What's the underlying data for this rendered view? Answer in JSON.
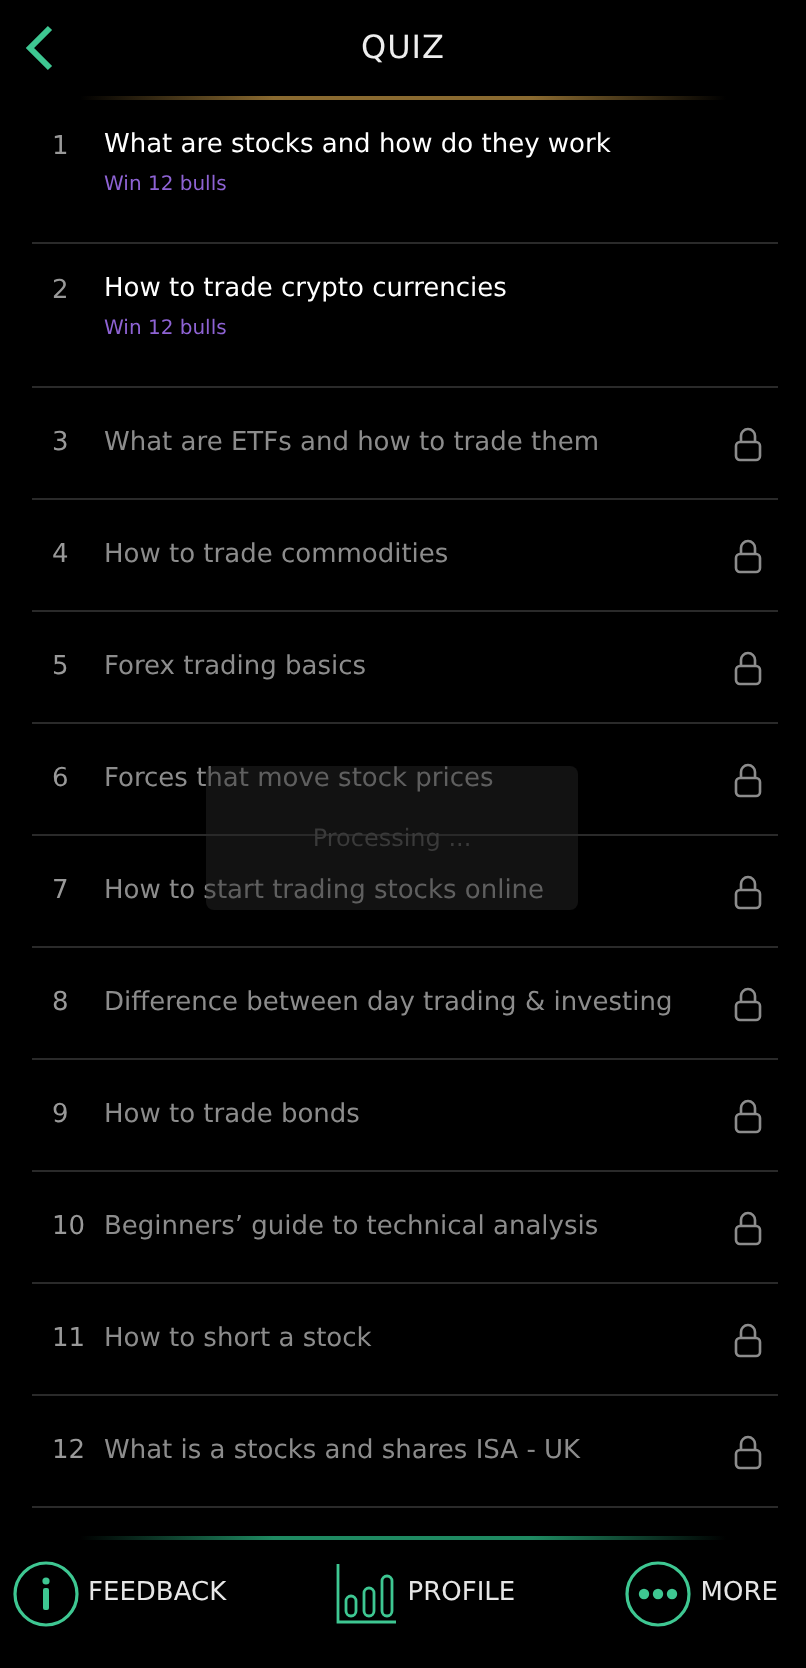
{
  "header": {
    "title": "QUIZ"
  },
  "quizzes": [
    {
      "number": "1",
      "title": "What are stocks and how do they work",
      "reward": "Win 12 bulls",
      "locked": false
    },
    {
      "number": "2",
      "title": "How to trade crypto currencies",
      "reward": "Win 12 bulls",
      "locked": false
    },
    {
      "number": "3",
      "title": "What are ETFs and how to trade them",
      "locked": true
    },
    {
      "number": "4",
      "title": "How to trade commodities",
      "locked": true
    },
    {
      "number": "5",
      "title": "Forex trading basics",
      "locked": true
    },
    {
      "number": "6",
      "title": "Forces that move stock prices",
      "locked": true
    },
    {
      "number": "7",
      "title": "How to start trading stocks online",
      "locked": true
    },
    {
      "number": "8",
      "title": "Difference between day trading & investing",
      "locked": true
    },
    {
      "number": "9",
      "title": "How to trade bonds",
      "locked": true
    },
    {
      "number": "10",
      "title": "Beginners’ guide to technical analysis",
      "locked": true
    },
    {
      "number": "11",
      "title": "How to short a stock",
      "locked": true
    },
    {
      "number": "12",
      "title": "What is a stocks and shares ISA - UK",
      "locked": true
    }
  ],
  "overlay": {
    "text": "Processing ..."
  },
  "bottom_nav": [
    {
      "kind": "info",
      "label": "FEEDBACK"
    },
    {
      "kind": "chart",
      "label": "PROFILE"
    },
    {
      "kind": "more",
      "label": "MORE"
    }
  ]
}
